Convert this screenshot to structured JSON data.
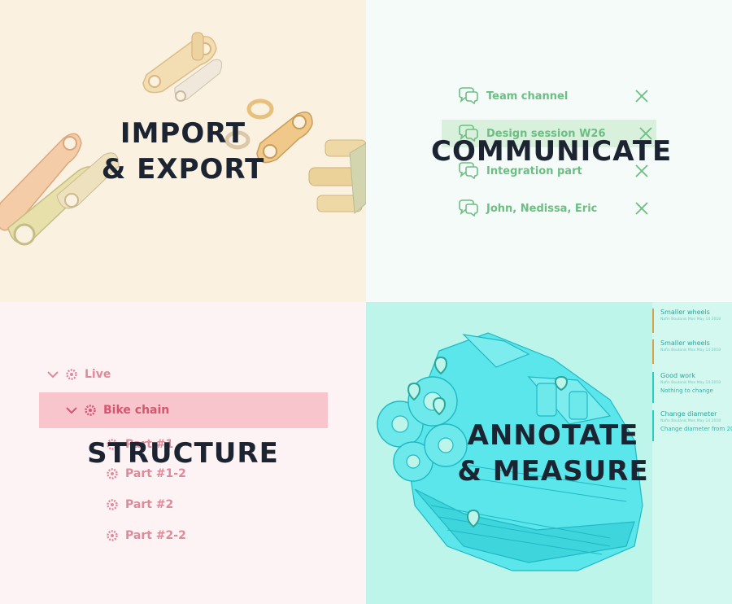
{
  "import_export": {
    "title_line1": "IMPORT",
    "title_line2": "& EXPORT",
    "background": "#fbf1e0"
  },
  "communicate": {
    "title": "COMMUNICATE",
    "background": "#f5fbf8",
    "accent": "#6bbf82",
    "channels": [
      {
        "label": "Team channel",
        "icon": "chat-icon",
        "action": "close-icon"
      },
      {
        "label": "Design session W26",
        "icon": "chat-icon",
        "action": "close-icon",
        "selected": true
      },
      {
        "label": "Integration part",
        "icon": "chat-icon",
        "action": "close-icon"
      },
      {
        "label": "John, Nedissa, Eric",
        "icon": "chat-icon",
        "action": "close-icon"
      }
    ]
  },
  "structure": {
    "title": "STRUCTURE",
    "background": "#fef3f4",
    "accent": "#d4566f",
    "tree": [
      {
        "label": "Live",
        "level": 0,
        "expanded": true,
        "icon": "gear-icon"
      },
      {
        "label": "Bike chain",
        "level": 1,
        "expanded": true,
        "selected": true,
        "icon": "gear-icon"
      },
      {
        "label": "Part #1",
        "level": 2,
        "icon": "gear-icon"
      },
      {
        "label": "Part #1-2",
        "level": 2,
        "icon": "gear-icon"
      },
      {
        "label": "Part #2",
        "level": 2,
        "icon": "gear-icon"
      },
      {
        "label": "Part #2-2",
        "level": 2,
        "icon": "gear-icon"
      }
    ]
  },
  "annotate": {
    "title_line1": "ANNOTATE",
    "title_line2": "& MEASURE",
    "background": "#bdf5ea",
    "notes": [
      {
        "title": "Smaller wheels",
        "meta": "Nafin Boulanis    Mon May 14 2018",
        "body": "",
        "color": "#d8a24a"
      },
      {
        "title": "Smaller wheels",
        "meta": "Nafin Boulanis    Mon May 14 2018",
        "body": "",
        "color": "#d8a24a"
      },
      {
        "title": "Good work",
        "meta": "Nafin Boulanis    Mon May 14 2018",
        "body": "Nothing to change",
        "color": "#26cfc1"
      },
      {
        "title": "Change diameter",
        "meta": "Nafin Boulanis    Mon May 14 2018",
        "body": "Change diameter from 20",
        "color": "#26cfc1"
      }
    ]
  }
}
